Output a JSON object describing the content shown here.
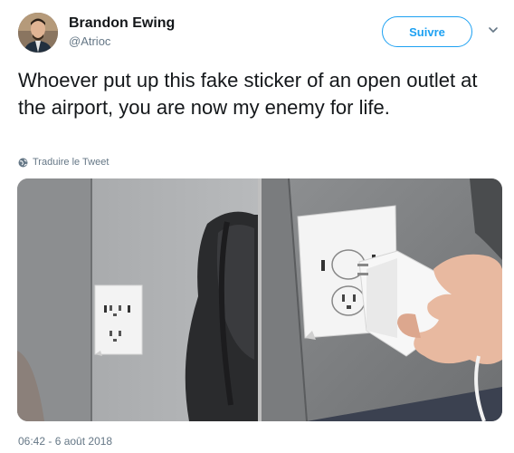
{
  "author": {
    "name": "Brandon Ewing",
    "handle": "@Atrioc"
  },
  "follow": {
    "label": "Suivre"
  },
  "icons": {
    "avatar": "profile-photo",
    "caret": "chevron-down-icon",
    "translate": "globe-icon"
  },
  "tweet": {
    "text": "Whoever put up this fake sticker of an open outlet at the airport, you are now my enemy for life.",
    "translate_label": "Traduire le Tweet",
    "timestamp": "06:42 - 6 août 2018"
  },
  "colors": {
    "accent": "#1da1f2",
    "secondary_text": "#657786",
    "primary_text": "#14171a"
  }
}
